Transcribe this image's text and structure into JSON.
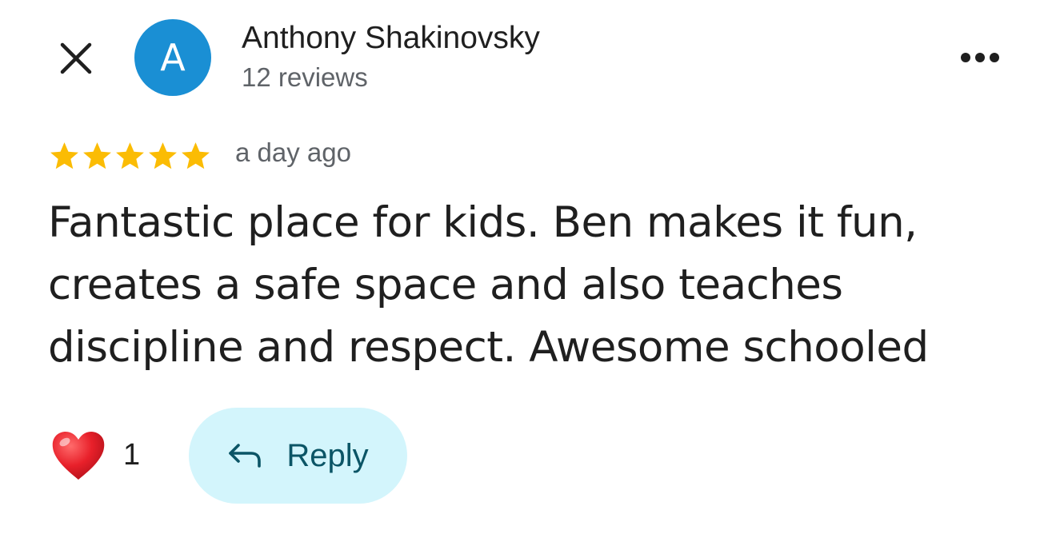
{
  "header": {
    "close_icon": "close-icon",
    "avatar_letter": "A",
    "avatar_color": "#1a8fd4",
    "author_name": "Anthony Shakinovsky",
    "review_count": "12 reviews",
    "more_icon": "more-horizontal-icon"
  },
  "rating": {
    "stars": 5,
    "max_stars": 5,
    "star_color": "#fbbc04",
    "time_ago": "a day ago"
  },
  "review": {
    "lines": [
      "Fantastic place for kids. Ben makes it fun,",
      "creates a safe space and also teaches",
      "discipline and respect. Awesome schooled"
    ]
  },
  "footer": {
    "like_icon": "heart-icon",
    "like_count": "1",
    "reply_icon": "reply-arrow-icon",
    "reply_label": "Reply",
    "reply_bg_color": "#d3f5fc",
    "reply_text_color": "#0b5566"
  }
}
